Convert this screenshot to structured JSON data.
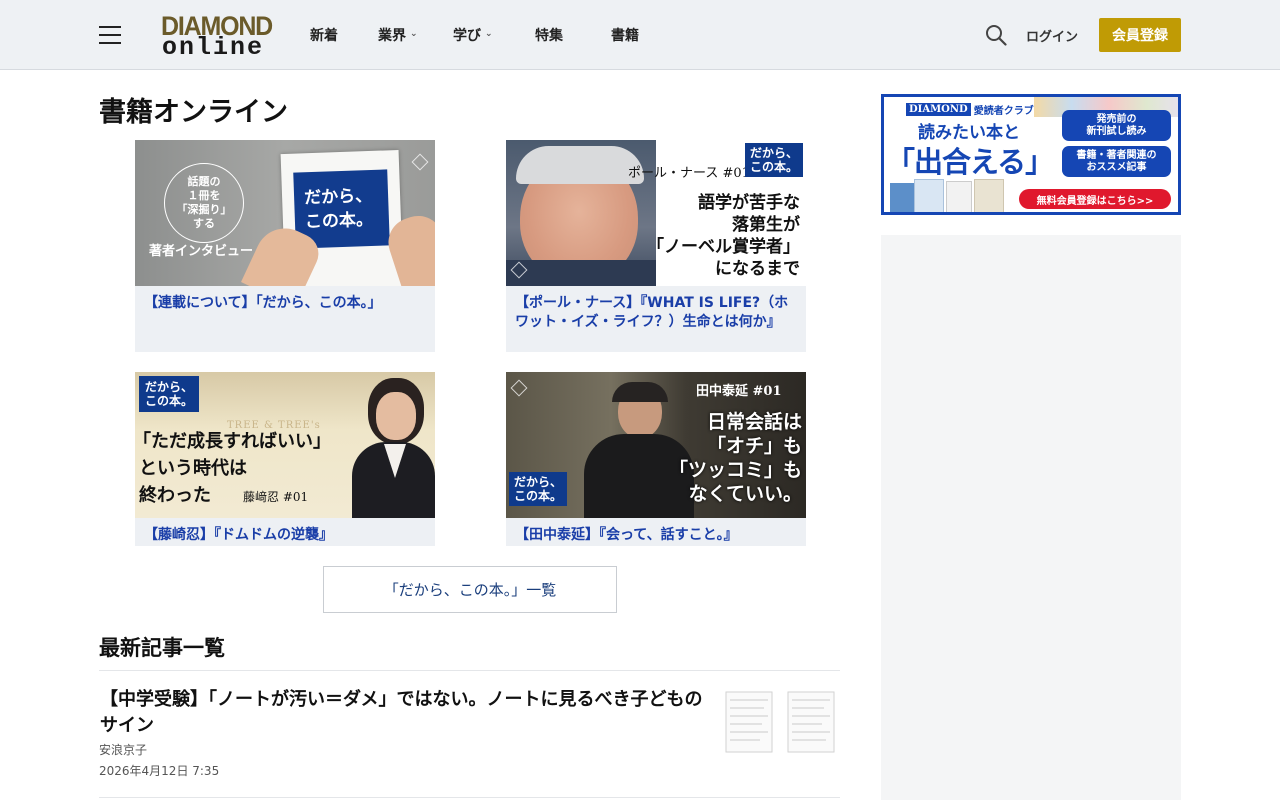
{
  "header": {
    "logo_top": "DIAMOND",
    "logo_bottom": "online",
    "nav": [
      {
        "label": "新着",
        "dropdown": false
      },
      {
        "label": "業界",
        "dropdown": true
      },
      {
        "label": "学び",
        "dropdown": true
      },
      {
        "label": "特集",
        "dropdown": false
      },
      {
        "label": "書籍",
        "dropdown": false
      }
    ],
    "dropdown_glyph": "⌄",
    "login_label": "ログイン",
    "register_label": "会員登録"
  },
  "main": {
    "page_title": "書籍オンライン",
    "cards": [
      {
        "caption": "【連載について】「だから、この本。」",
        "thumb": {
          "circle_text": [
            "話題の",
            "１冊を",
            "「深掘り」",
            "する"
          ],
          "sub_text": "著者インタビュー",
          "paper_text": [
            "だから、",
            "この本。"
          ]
        }
      },
      {
        "caption": "【ポール・ナース】『WHAT IS LIFE?（ホワット・イズ・ライフ？）生命とは何か』",
        "thumb": {
          "name": "ポール・ナース #01",
          "badge": [
            "だから、",
            "この本。"
          ],
          "headline": [
            "語学が苦手な",
            "落第生が",
            "「ノーベル賞学者」",
            "になるまで"
          ]
        }
      },
      {
        "caption": "【藤崎忍】『ドムドムの逆襲』",
        "thumb": {
          "badge": [
            "だから、",
            "この本。"
          ],
          "sign": "TREE & TREE's",
          "headline": [
            "「ただ成長すればいい」",
            "という時代は",
            "終わった"
          ],
          "name": "藤﨑忍 #01"
        }
      },
      {
        "caption": "【田中泰延】『会って、話すこと。』",
        "thumb": {
          "name": "田中泰延 #01",
          "badge": [
            "だから、",
            "この本。"
          ],
          "headline": [
            "日常会話は",
            "「オチ」も",
            "「ツッコミ」も",
            "なくていい。"
          ]
        }
      }
    ],
    "list_button": "「だから、この本。」一覧",
    "latest_title": "最新記事一覧",
    "article": {
      "title": "【中学受験】「ノートが汚い＝ダメ」ではない。ノートに見るべき子どものサイン",
      "author": "安浪京子",
      "date": "2026年4月12日 7:35"
    }
  },
  "sidebar": {
    "ad": {
      "brand": "DIAMOND",
      "club": "愛読者クラブ",
      "line1": "読みたい本と",
      "line2": "「出合える」",
      "pill1": [
        "発売前の",
        "新刊試し読み"
      ],
      "pill2": [
        "書籍・著者関連の",
        "おススメ記事"
      ],
      "cta": "無料会員登録はこちら>>"
    }
  },
  "colors": {
    "header_bg": "#eef1f4",
    "register_bg": "#c09b05",
    "caption_link": "#1a3ea8",
    "badge_blue": "#0f3a8c",
    "ad_blue": "#1546b4",
    "ad_red": "#e0182d"
  }
}
